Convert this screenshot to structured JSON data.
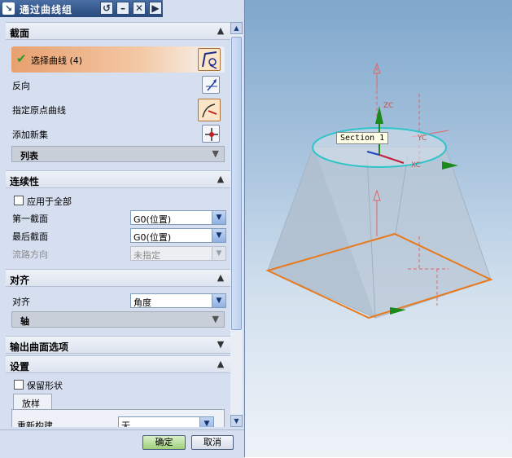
{
  "dialog": {
    "title": "通过曲线组",
    "title_buttons": [
      "↺",
      "–",
      "✕",
      "▶"
    ]
  },
  "sections": {
    "section": {
      "title": "截面",
      "select_curve_label": "选择曲线 (4)",
      "reverse_label": "反向",
      "origin_curve_label": "指定原点曲线",
      "add_new_set_label": "添加新集",
      "list_label": "列表"
    },
    "continuity": {
      "title": "连续性",
      "apply_all_label": "应用于全部",
      "first_section_label": "第一截面",
      "first_section_value": "G0(位置)",
      "last_section_label": "最后截面",
      "last_section_value": "G0(位置)",
      "flow_direction_label": "流路方向",
      "flow_direction_value": "未指定"
    },
    "alignment": {
      "title": "对齐",
      "align_label": "对齐",
      "align_value": "角度",
      "axis_label": "轴"
    },
    "output": {
      "title": "输出曲面选项"
    },
    "settings": {
      "title": "设置",
      "keep_shape_label": "保留形状",
      "tab_label": "放样",
      "rebuild_label": "重新构建",
      "rebuild_value": "无"
    }
  },
  "buttons": {
    "ok": "确定",
    "cancel": "取消"
  },
  "viewport": {
    "section_label": "Section  1",
    "axis_labels": [
      "ZC",
      "YC",
      "XC"
    ]
  },
  "colors": {
    "accent_orange": "#e87a1e",
    "section_cyan": "#2ec4c8",
    "check_green": "#2a9a2a"
  }
}
